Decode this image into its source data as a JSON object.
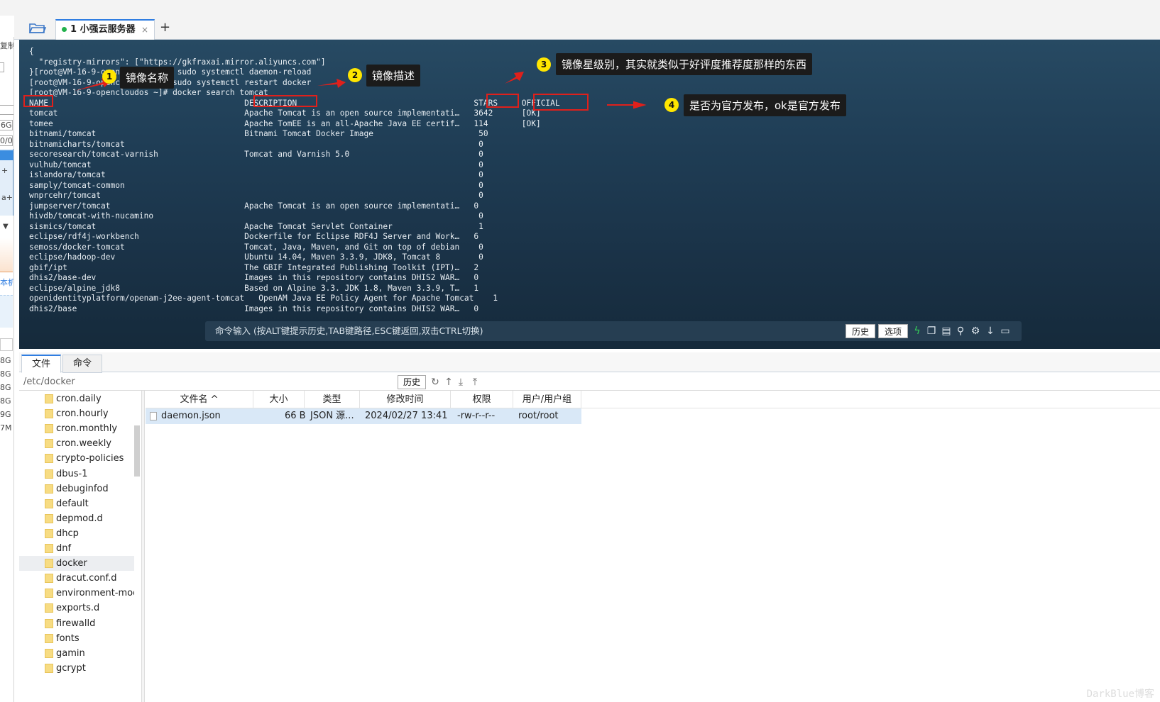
{
  "tabbar": {
    "tab_label": "1 小强云服务器",
    "close": "×",
    "add": "+"
  },
  "left_strip": [
    "复制",
    "6G",
    "0/0",
    "+",
    "a+",
    "本机",
    "8G",
    "8G",
    "8G",
    "8G",
    "9G",
    "7M"
  ],
  "terminal": {
    "lines": "{\n  \"registry-mirrors\": [\"https://gkfraxai.mirror.aliyuncs.com\"]\n}[root@VM-16-9-opencloudos ~]# sudo systemctl daemon-reload\n[root@VM-16-9-opencloudos ~]# sudo systemctl restart docker\n[root@VM-16-9-opencloudos ~]# docker search tomcat\nNAME                                         DESCRIPTION                                     STARS     OFFICIAL\ntomcat                                       Apache Tomcat is an open source implementati…   3642      [OK]\ntomee                                        Apache TomEE is an all-Apache Java EE certif…   114       [OK]\nbitnami/tomcat                               Bitnami Tomcat Docker Image                      50\nbitnamicharts/tomcat                                                                          0\nsecoresearch/tomcat-varnish                  Tomcat and Varnish 5.0                           0\nvulhub/tomcat                                                                                 0\nislandora/tomcat                                                                              0\nsamply/tomcat-common                                                                          0\nwnprcehr/tomcat                                                                               0\njumpserver/tomcat                            Apache Tomcat is an open source implementati…   0\nhivdb/tomcat-with-nucamino                                                                    0\nsismics/tomcat                               Apache Tomcat Servlet Container                  1\neclipse/rdf4j-workbench                      Dockerfile for Eclipse RDF4J Server and Work…   6\nsemoss/docker-tomcat                         Tomcat, Java, Maven, and Git on top of debian    0\neclipse/hadoop-dev                           Ubuntu 14.04, Maven 3.3.9, JDK8, Tomcat 8        0\ngbif/ipt                                     The GBIF Integrated Publishing Toolkit (IPT)…   2\ndhis2/base-dev                               Images in this repository contains DHIS2 WAR…   0\neclipse/alpine_jdk8                          Based on Alpine 3.3. JDK 1.8, Maven 3.3.9, T…   1\nopenidentityplatform/openam-j2ee-agent-tomcat   OpenAM Java EE Policy Agent for Apache Tomcat    1\ndhis2/base                                   Images in this repository contains DHIS2 WAR…   0",
    "annotations": [
      {
        "num": "1",
        "text": "镜像名称"
      },
      {
        "num": "2",
        "text": "镜像描述"
      },
      {
        "num": "3",
        "text": "镜像星级别，其实就类似于好评度推荐度那样的东西"
      },
      {
        "num": "4",
        "text": "是否为官方发布，ok是官方发布"
      }
    ],
    "cmd_placeholder": "命令输入 (按ALT键提示历史,TAB键路径,ESC键返回,双击CTRL切换)",
    "history_btn": "历史",
    "options_btn": "选项"
  },
  "bottom_tabs": [
    "文件",
    "命令"
  ],
  "path": {
    "value": "/etc/docker",
    "history_btn": "历史"
  },
  "tree_items": [
    "cron.daily",
    "cron.hourly",
    "cron.monthly",
    "cron.weekly",
    "crypto-policies",
    "dbus-1",
    "debuginfod",
    "default",
    "depmod.d",
    "dhcp",
    "dnf",
    "docker",
    "dracut.conf.d",
    "environment-modules",
    "exports.d",
    "firewalld",
    "fonts",
    "gamin",
    "gcrypt"
  ],
  "selected_tree_item": "docker",
  "file_table": {
    "headers": [
      "文件名 ^",
      "大小",
      "类型",
      "修改时间",
      "权限",
      "用户/用户组"
    ],
    "rows": [
      [
        "daemon.json",
        "66 B",
        "JSON 源...",
        "2024/02/27 13:41",
        "-rw-r--r--",
        "root/root"
      ]
    ]
  },
  "watermark": "DarkBlue博客"
}
